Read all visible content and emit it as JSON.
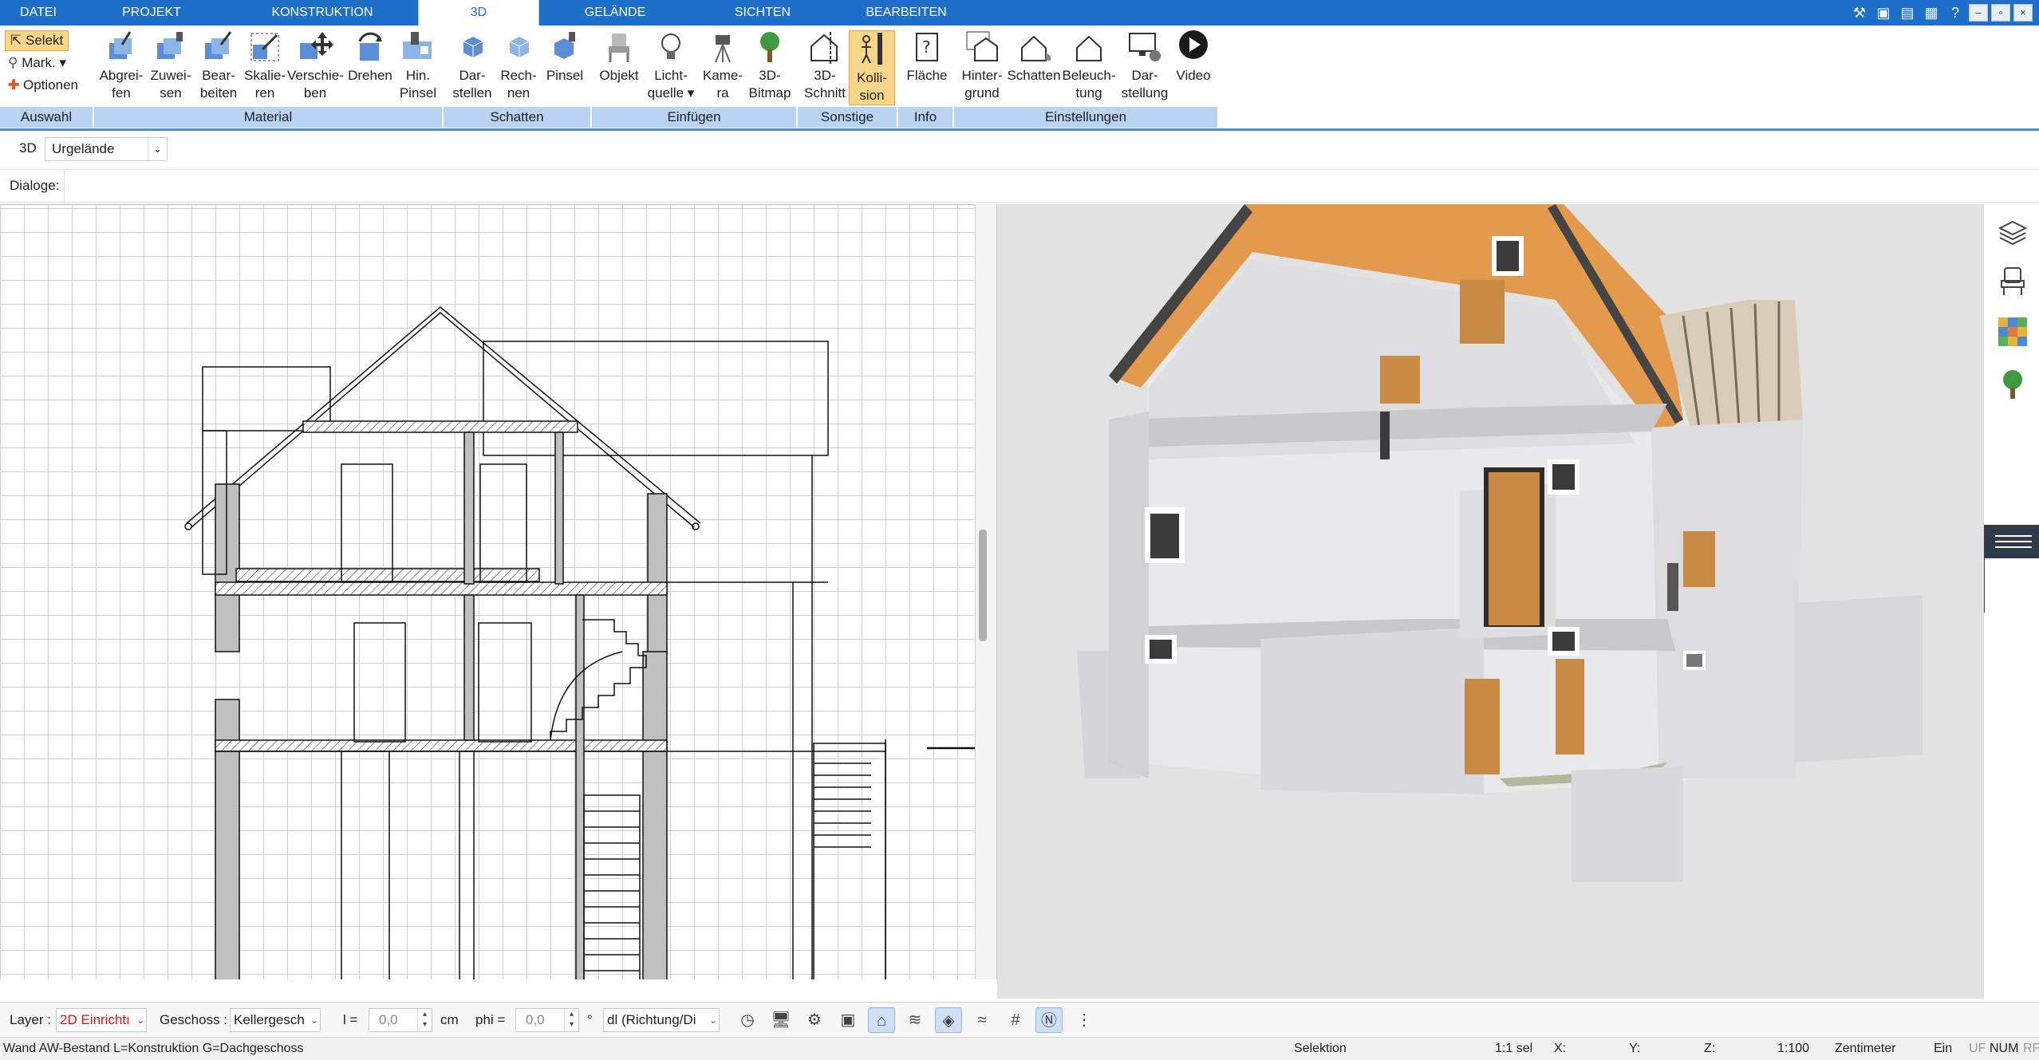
{
  "menu": {
    "tabs": [
      "DATEI",
      "PROJEKT",
      "KONSTRUKTION",
      "3D",
      "GELÄNDE",
      "SICHTEN",
      "BEARBEITEN"
    ],
    "active_tab": "3D"
  },
  "ribbon": {
    "selection": {
      "select": "Selekt",
      "mark": "Mark.",
      "options": "Optionen"
    },
    "buttons": {
      "abgreifen": "Abgrei-\nfen",
      "zuweisen": "Zuwei-\nsen",
      "bearbeiten": "Bear-\nbeiten",
      "skalieren": "Skalie-\nren",
      "verschieben": "Verschie-\nben",
      "drehen": "Drehen",
      "hin_pinsel": "Hin.\nPinsel",
      "darstellen": "Dar-\nstellen",
      "rechnen": "Rech-\nnen",
      "pinsel": "Pinsel",
      "objekt": "Objekt",
      "lichtquelle": "Licht-\nquelle",
      "kamera": "Kame-\nra",
      "bitmap3d": "3D-\nBitmap",
      "schnitt3d": "3D-\nSchnitt",
      "kollision": "Kolli-\nsion",
      "flaeche": "Fläche",
      "hintergrund": "Hinter-\ngrund",
      "schatten": "Schatten",
      "beleuchtung": "Beleuch-\ntung",
      "darstellung": "Dar-\nstellung",
      "video": "Video"
    },
    "groups": [
      "Auswahl",
      "Material",
      "Schatten",
      "Einfügen",
      "Sonstige",
      "Info",
      "Einstellungen"
    ]
  },
  "subbar": {
    "mode": "3D",
    "terrain_select": "Urgelände"
  },
  "dialog_bar": {
    "label": "Dialoge:"
  },
  "bottombar": {
    "layer_label": "Layer :",
    "layer_value": "2D Einrichtı",
    "geschoss_label": "Geschoss :",
    "geschoss_value": "Kellergesch",
    "l_label": "l =",
    "l_value": "0,0",
    "l_unit": "cm",
    "phi_label": "phi =",
    "phi_value": "0,0",
    "phi_unit": "°",
    "direction_value": "dl (Richtung/Di"
  },
  "statusbar": {
    "message": "Wand AW-Bestand L=Konstruktion G=Dachgeschoss",
    "mode": "Selektion",
    "sel": "1:1 sel",
    "x": "X:",
    "y": "Y:",
    "z": "Z:",
    "scale": "1:100",
    "unit": "Zentimeter",
    "ein": "Ein",
    "uf": "UF",
    "num": "NUM",
    "rf": "RF"
  },
  "colors": {
    "menubar": "#1e6fc9",
    "ribbon_group": "#b9d3f2",
    "active_button": "#fbd68a",
    "roof_orange": "#e0964a",
    "door_wood": "#c98a45"
  }
}
